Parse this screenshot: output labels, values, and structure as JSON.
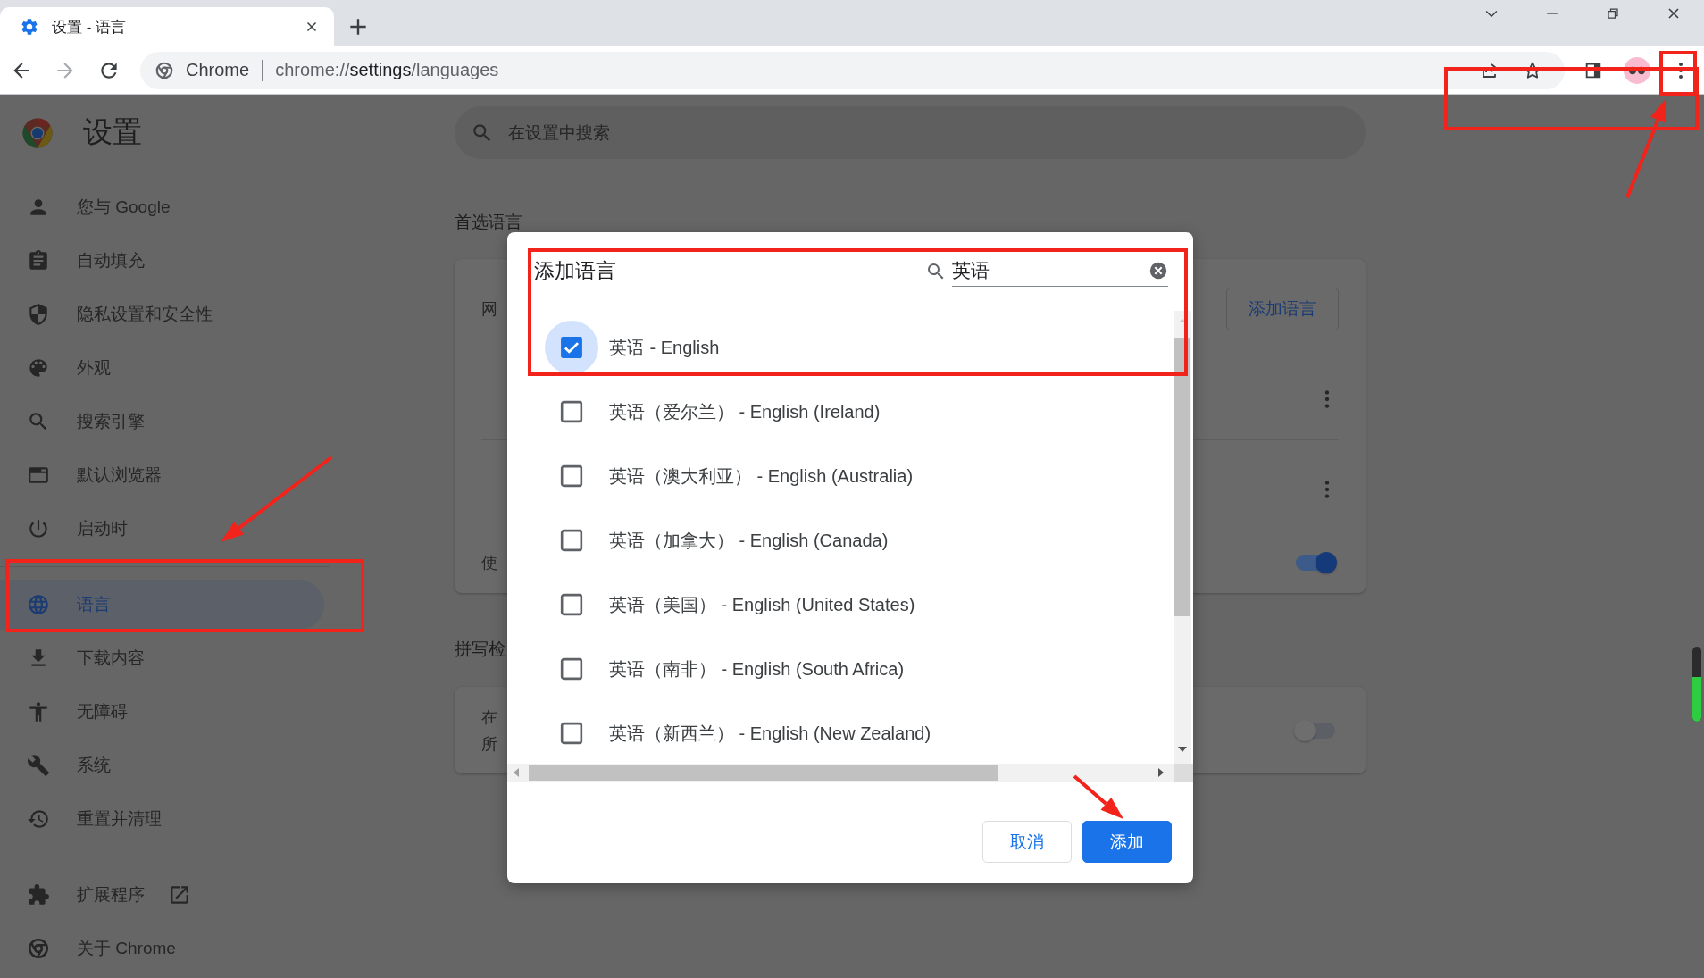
{
  "tab": {
    "title": "设置 - 语言"
  },
  "omnibox": {
    "site_label": "Chrome",
    "url": "chrome://**settings**/languages"
  },
  "settings": {
    "title": "设置",
    "search": {
      "placeholder": "在设置中搜索"
    }
  },
  "sidebar": {
    "items": [
      {
        "label": "您与 Google",
        "selected": false
      },
      {
        "label": "自动填充",
        "selected": false
      },
      {
        "label": "隐私设置和安全性",
        "selected": false
      },
      {
        "label": "外观",
        "selected": false
      },
      {
        "label": "搜索引擎",
        "selected": false
      },
      {
        "label": "默认浏览器",
        "selected": false
      },
      {
        "label": "启动时",
        "selected": false
      },
      {
        "label": "语言",
        "selected": true
      },
      {
        "label": "下载内容",
        "selected": false
      },
      {
        "label": "无障碍",
        "selected": false
      },
      {
        "label": "系统",
        "selected": false
      },
      {
        "label": "重置并清理",
        "selected": false
      }
    ],
    "footer_items": [
      {
        "label": "扩展程序",
        "external": true
      },
      {
        "label": "关于 Chrome",
        "external": false
      }
    ]
  },
  "content": {
    "preferred": {
      "heading": "首选语言",
      "row_text": "网",
      "add_button": "添加语言",
      "bottom_text": "使",
      "toggle_on": true
    },
    "spellcheck": {
      "heading": "拼写检",
      "line_1": "在",
      "line_2": "所",
      "toggle_on": false
    }
  },
  "dialog": {
    "title": "添加语言",
    "search": {
      "value": "英语"
    },
    "options": [
      {
        "label": "英语 - English",
        "checked": true,
        "focused": true
      },
      {
        "label": "英语（爱尔兰） - English (Ireland)",
        "checked": false,
        "focused": false
      },
      {
        "label": "英语（澳大利亚） - English (Australia)",
        "checked": false,
        "focused": false
      },
      {
        "label": "英语（加拿大） - English (Canada)",
        "checked": false,
        "focused": false
      },
      {
        "label": "英语（美国） - English (United States)",
        "checked": false,
        "focused": false
      },
      {
        "label": "英语（南非） - English (South Africa)",
        "checked": false,
        "focused": false
      },
      {
        "label": "英语（新西兰） - English (New Zealand)",
        "checked": false,
        "focused": false
      }
    ],
    "buttons": [
      {
        "label": "取消",
        "kind": "secondary"
      },
      {
        "label": "添加",
        "kind": "primary"
      }
    ]
  }
}
